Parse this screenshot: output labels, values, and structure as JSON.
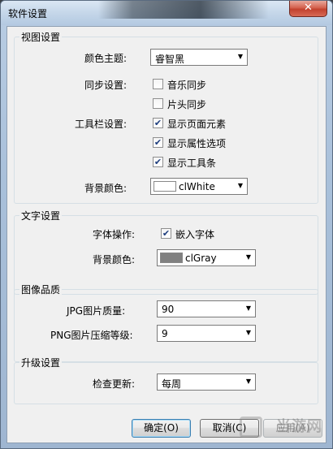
{
  "window": {
    "title": "软件设置",
    "close_symbol": "✕"
  },
  "view": {
    "legend": "视图设置",
    "theme_label": "颜色主题:",
    "theme_value": "睿智黑",
    "sync_label": "同步设置:",
    "music_sync": {
      "label": "音乐同步",
      "checked": false
    },
    "header_sync": {
      "label": "片头同步",
      "checked": false
    },
    "toolbar_label": "工具栏设置:",
    "show_page_elements": {
      "label": "显示页面元素",
      "checked": true
    },
    "show_props": {
      "label": "显示属性选项",
      "checked": true
    },
    "show_toolbar": {
      "label": "显示工具条",
      "checked": true
    },
    "bg_label": "背景颜色:",
    "bg_value": "clWhite",
    "bg_swatch": "#ffffff"
  },
  "text": {
    "legend": "文字设置",
    "font_label": "字体操作:",
    "embed_font": {
      "label": "嵌入字体",
      "checked": true
    },
    "bg_label": "背景颜色:",
    "bg_value": "clGray",
    "bg_swatch": "#808080"
  },
  "image": {
    "legend": "图像品质",
    "jpg_label": "JPG图片质量:",
    "jpg_value": "90",
    "png_label": "PNG图片压缩等级:",
    "png_value": "9"
  },
  "upgrade": {
    "legend": "升级设置",
    "check_label": "检查更新:",
    "check_value": "每周"
  },
  "buttons": {
    "ok": "确定(O)",
    "cancel": "取消(C)",
    "apply": "应用(A)"
  },
  "watermark": "当游网"
}
